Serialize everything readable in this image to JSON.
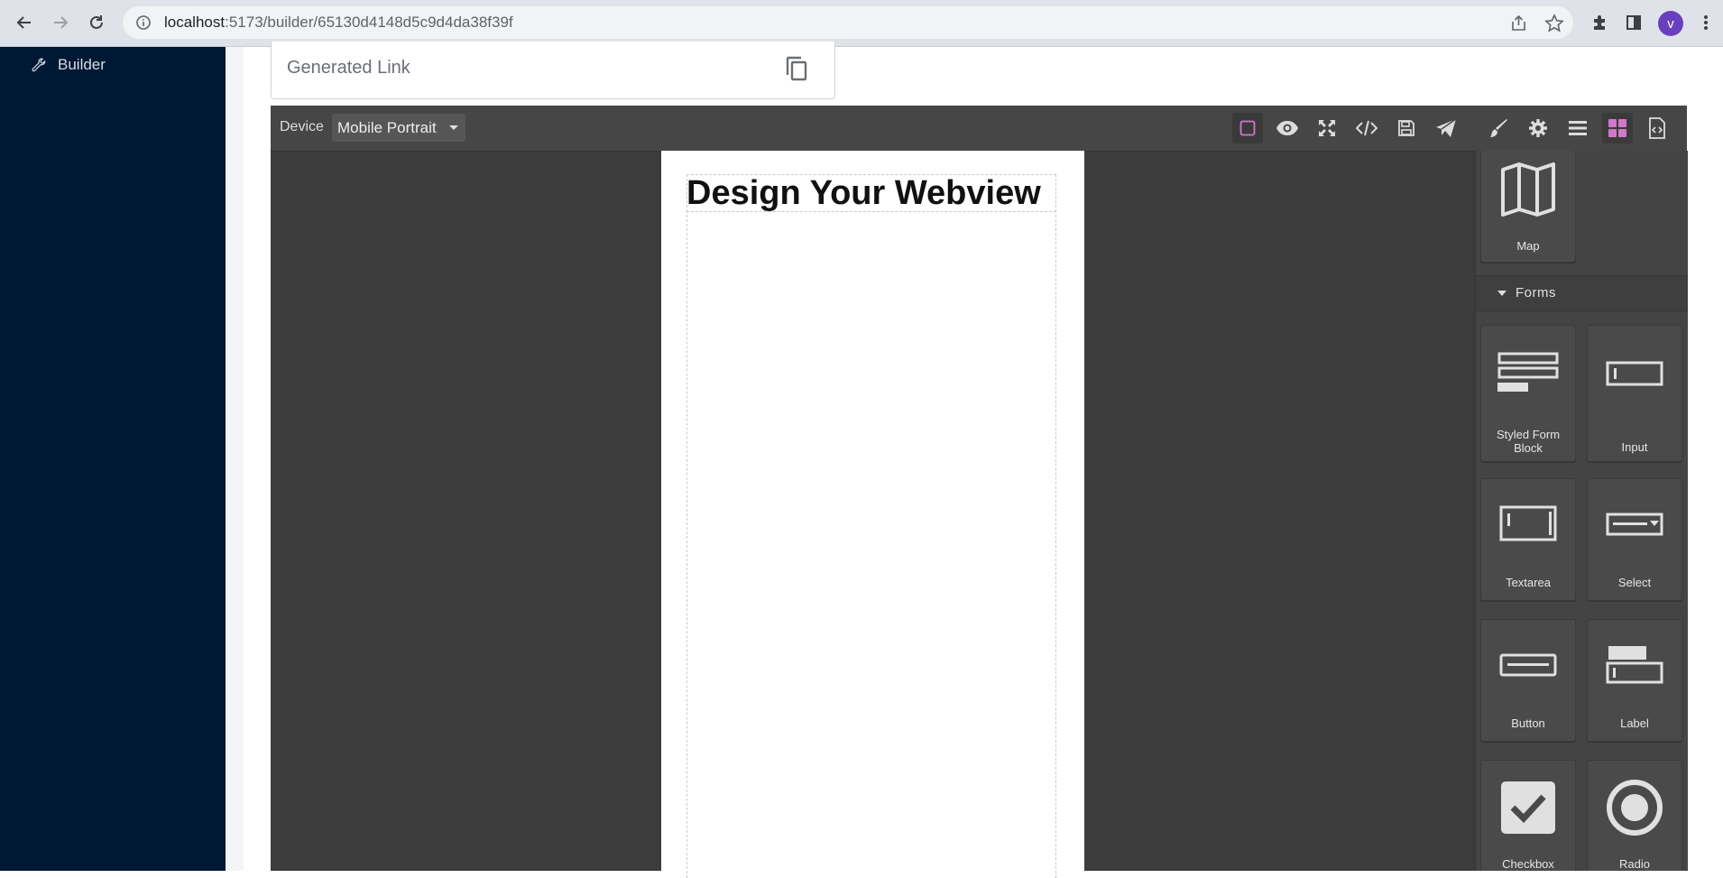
{
  "browser": {
    "url_host": "localhost",
    "url_path": ":5173/builder/65130d4148d5c9d4da38f39f",
    "avatar_letter": "v"
  },
  "sidebar": {
    "items": [
      {
        "label": "Builder",
        "icon": "wrench-icon"
      }
    ]
  },
  "link_card": {
    "label": "Generated Link",
    "icon": "copy-icon"
  },
  "editor": {
    "device_label": "Device",
    "device_value": "Mobile Portrait",
    "toolbar_icons": [
      "sw-visibility-icon",
      "preview-eye-icon",
      "fullscreen-icon",
      "code-icon",
      "save-icon",
      "send-icon",
      "style-manager-brush-icon",
      "settings-gear-icon",
      "layer-manager-icon",
      "blocks-icon",
      "import-code-icon"
    ],
    "accent": "#d278c9",
    "canvas": {
      "heading": "Design Your Webview"
    },
    "blocks": {
      "map_label": "Map",
      "forms_category": "Forms",
      "items": [
        {
          "label": "Styled Form Block",
          "icon": "styled-form-block-icon"
        },
        {
          "label": "Input",
          "icon": "input-icon"
        },
        {
          "label": "Textarea",
          "icon": "textarea-icon"
        },
        {
          "label": "Select",
          "icon": "select-icon"
        },
        {
          "label": "Button",
          "icon": "button-block-icon"
        },
        {
          "label": "Label",
          "icon": "label-icon"
        },
        {
          "label": "Checkbox",
          "icon": "checkbox-icon"
        },
        {
          "label": "Radio",
          "icon": "radio-icon"
        }
      ]
    }
  }
}
